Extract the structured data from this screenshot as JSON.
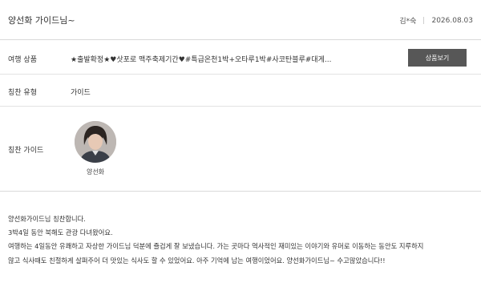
{
  "review": {
    "title": "양선화 가이드님~",
    "author": "김*숙",
    "date": "2026.08.03"
  },
  "rows": {
    "product": {
      "label": "여행 상품",
      "value": "★출발확정★♥삿포로 맥주축제기간♥#특급온천1박+오타루1박#사코탄블루#대게...",
      "button_label": "상품보기"
    },
    "type": {
      "label": "칭찬 유형",
      "value": "가이드"
    },
    "guide": {
      "label": "칭찬 가이드",
      "name": "양선화"
    }
  },
  "body": {
    "lines": [
      "양선화가이드님 칭찬합니다.",
      "3박4일 동안 북해도 관광 다녀왔어요.",
      "여행하는 4일동안 유쾌하고 자상한 가이드님 덕분에 즐겁게 잘 보냈습니다. 가는 곳마다 역사적인 재미있는 이야기와 유머로 이동하는 동안도 지루하지",
      "않고 식사때도 친절하게 살펴주어 더 맛있는 식사도 할 수 있었어요. 아주 기억에 남는 여행이었어요. 양선화가이드님~ 수고많았습니다!!"
    ]
  },
  "colors": {
    "button_bg": "#575757",
    "divider": "#e3e3e3"
  },
  "icons": {
    "guide_photo": "guide-avatar-photo"
  }
}
